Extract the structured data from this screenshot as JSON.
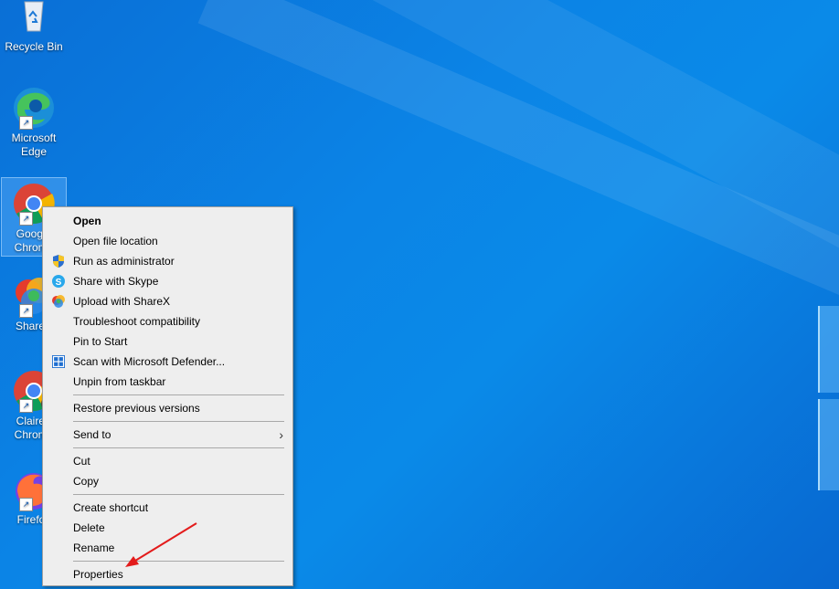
{
  "desktop": {
    "icons": [
      {
        "label": "Recycle Bin",
        "icon": "recycle-bin-icon"
      },
      {
        "label": "Microsoft Edge",
        "icon": "edge-icon"
      },
      {
        "label": "Google Chrome",
        "icon": "chrome-icon"
      },
      {
        "label": "ShareX",
        "icon": "sharex-icon"
      },
      {
        "label": "Claire - Chrome",
        "icon": "chrome-profile-icon"
      },
      {
        "label": "Firefox",
        "icon": "firefox-icon"
      }
    ],
    "accent_color": "#0a7ae0"
  },
  "context_menu": {
    "items": [
      {
        "label": "Open",
        "bold": true
      },
      {
        "label": "Open file location"
      },
      {
        "label": "Run as administrator",
        "icon": "uac-shield-icon"
      },
      {
        "label": "Share with Skype",
        "icon": "skype-icon"
      },
      {
        "label": "Upload with ShareX",
        "icon": "sharex-icon"
      },
      {
        "label": "Troubleshoot compatibility"
      },
      {
        "label": "Pin to Start"
      },
      {
        "label": "Scan with Microsoft Defender...",
        "icon": "defender-icon"
      },
      {
        "label": "Unpin from taskbar"
      },
      {
        "label": "Restore previous versions"
      },
      {
        "label": "Send to",
        "submenu": true
      },
      {
        "label": "Cut"
      },
      {
        "label": "Copy"
      },
      {
        "label": "Create shortcut"
      },
      {
        "label": "Delete"
      },
      {
        "label": "Rename"
      },
      {
        "label": "Properties"
      }
    ]
  },
  "annotation": {
    "color": "#e31b1b",
    "target": "Properties"
  }
}
